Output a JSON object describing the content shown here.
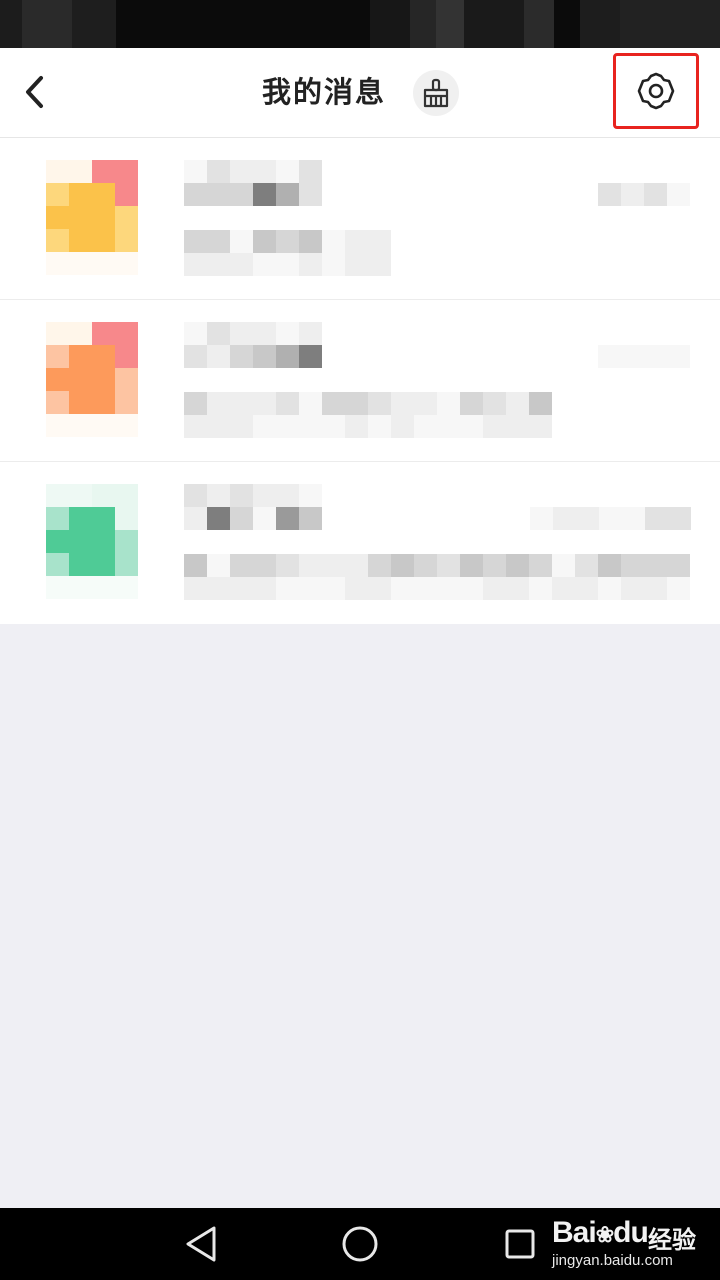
{
  "header": {
    "title": "我的消息",
    "back_icon": "chevron-left-icon",
    "clear_icon": "broom-icon",
    "settings_icon": "gear-icon"
  },
  "annotation": {
    "color": "#e8231f"
  },
  "messages": [
    {
      "avatar_colors": [
        "#fdd77c",
        "#fbc24a",
        "#f7888b"
      ],
      "content": "pixelated"
    },
    {
      "avatar_colors": [
        "#fdc4a2",
        "#fd9a5b",
        "#f7888b"
      ],
      "content": "pixelated"
    },
    {
      "avatar_colors": [
        "#a8e3cb",
        "#4fcb96",
        "#e8f7f0"
      ],
      "content": "pixelated"
    }
  ],
  "nav": {
    "back_icon": "triangle-back-icon",
    "home_icon": "circle-home-icon",
    "recents_icon": "square-recents-icon"
  },
  "watermark": {
    "brand": "Bai",
    "brand2": "du",
    "cn": "经验",
    "url": "jingyan.baidu.com"
  }
}
